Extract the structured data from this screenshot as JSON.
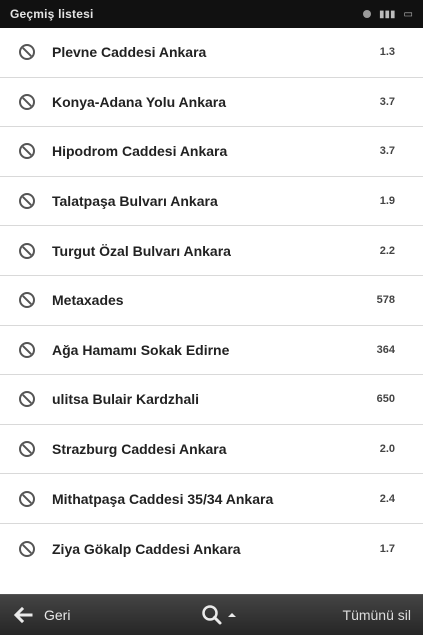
{
  "topbar": {
    "title": "Geçmiş listesi"
  },
  "history": {
    "items": [
      {
        "name": "Plevne Caddesi  Ankara",
        "distance": "1.3"
      },
      {
        "name": "Konya-Adana Yolu  Ankara",
        "distance": "3.7"
      },
      {
        "name": "Hipodrom Caddesi  Ankara",
        "distance": "3.7"
      },
      {
        "name": "Talatpaşa Bulvarı  Ankara",
        "distance": "1.9"
      },
      {
        "name": "Turgut Özal Bulvarı  Ankara",
        "distance": "2.2"
      },
      {
        "name": "Metaxades",
        "distance": "578"
      },
      {
        "name": "Ağa Hamamı Sokak  Edirne",
        "distance": "364"
      },
      {
        "name": "ulitsa Bulair  Kardzhali",
        "distance": "650"
      },
      {
        "name": "Strazburg Caddesi  Ankara",
        "distance": "2.0"
      },
      {
        "name": "Mithatpaşa Caddesi 35/34  Ankara",
        "distance": "2.4"
      },
      {
        "name": "Ziya Gökalp Caddesi  Ankara",
        "distance": "1.7"
      }
    ],
    "icon": "history-clock-icon"
  },
  "bottombar": {
    "back_label": "Geri",
    "back_icon": "arrow-left-icon",
    "zoom_icon": "magnifier-icon",
    "zoom_caret_icon": "caret-up-icon",
    "clear_label": "Tümünü sil"
  },
  "colors": {
    "topbar_bg": "#111111",
    "bottombar_bg": "#2f2f2f",
    "row_separator": "#d9d9d9",
    "text_primary": "#222222"
  }
}
